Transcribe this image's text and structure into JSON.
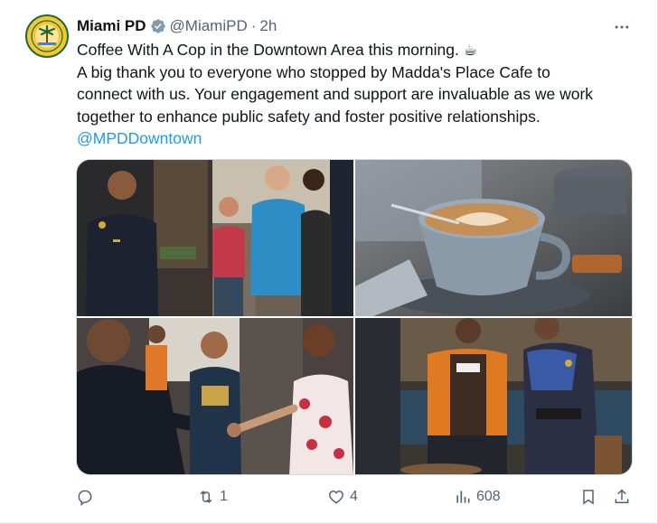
{
  "tweet": {
    "name": "Miami PD",
    "handle": "@MiamiPD",
    "separator": "·",
    "time": "2h",
    "lines": [
      "Coffee With A Cop in the Downtown Area this morning. ☕",
      "A big thank you to everyone who stopped by Madda's Place Cafe to",
      "connect with us. Your engagement and support are invaluable as we work",
      "together to enhance public safety and foster positive relationships."
    ],
    "mention": "@MPDDowntown"
  },
  "actions": {
    "replies": "",
    "retweets": "1",
    "likes": "4",
    "views": "608"
  },
  "icons": {
    "avatar": "miami-city-seal",
    "verified": "verified-badge-icon",
    "more": "more-dots-icon",
    "reply": "reply-icon",
    "retweet": "retweet-icon",
    "like": "heart-icon",
    "views": "views-icon",
    "bookmark": "bookmark-icon",
    "share": "share-icon"
  },
  "colors": {
    "verified": "#829aab",
    "link": "#1d9bf0",
    "secondary_text": "#536471"
  }
}
